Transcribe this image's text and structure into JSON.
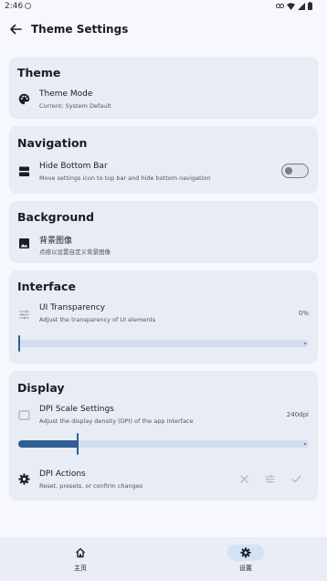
{
  "status": {
    "time": "2:46"
  },
  "header": {
    "title": "Theme Settings"
  },
  "theme": {
    "section_title": "Theme",
    "mode_title": "Theme Mode",
    "mode_sub": "Current: System Default"
  },
  "navigation": {
    "section_title": "Navigation",
    "hide_title": "Hide Bottom Bar",
    "hide_sub": "Move settings icon to top bar and hide bottom navigation",
    "hide_on": false
  },
  "background": {
    "section_title": "Background",
    "image_title": "背景图像",
    "image_sub": "点按以设置自定义背景图像"
  },
  "interface": {
    "section_title": "Interface",
    "transparency_title": "UI Transparency",
    "transparency_sub": "Adjust the transparency of UI elements",
    "transparency_value": "0%",
    "transparency_level": 0
  },
  "display": {
    "section_title": "Display",
    "dpi_title": "DPI Scale Settings",
    "dpi_sub": "Adjust the display density (DPI) of the app interface",
    "dpi_value": "240dpi",
    "dpi_level": 0.2,
    "actions_title": "DPI Actions",
    "actions_sub": "Reset, presets, or confirm changes"
  },
  "bottom_nav": {
    "home_label": "主页",
    "settings_label": "设置",
    "active": "settings",
    "accent": "#d3e2f7"
  },
  "colors": {
    "accent": "#2f5f93",
    "card": "#e8ecf5",
    "background": "#f6f8fd"
  }
}
